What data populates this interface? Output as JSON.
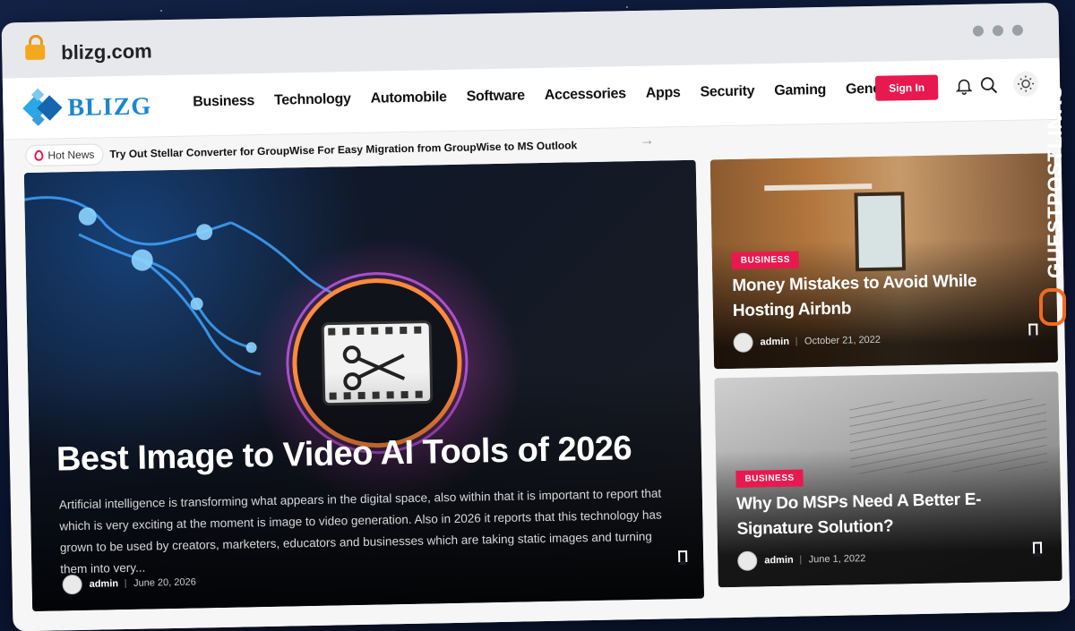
{
  "browser": {
    "url": "blizg.com"
  },
  "header": {
    "logo_text": "BLIZG",
    "nav": [
      "Business",
      "Technology",
      "Automobile",
      "Software",
      "Accessories",
      "Apps",
      "Security",
      "Gaming",
      "General"
    ],
    "signin_label": "Sign In"
  },
  "ticker": {
    "label": "Hot News",
    "headline": "Try Out Stellar Converter for GroupWise For Easy Migration from GroupWise to MS Outlook",
    "arrow": "→"
  },
  "hero": {
    "title": "Best Image to Video AI Tools of 2026",
    "excerpt": "Artificial intelligence is transforming what appears in the digital space, also within that it is important to report that which is very exciting at the moment is image to video generation. Also in 2026 it reports that this technology has grown to be used by creators, marketers, educators and businesses which are taking static images and turning them into very...",
    "author": "admin",
    "date": "June 20, 2026"
  },
  "cards": [
    {
      "category": "BUSINESS",
      "title": "Money Mistakes to Avoid While Hosting Airbnb",
      "author": "admin",
      "date": "October 21, 2022"
    },
    {
      "category": "BUSINESS",
      "title": "Why Do MSPs Need A Better E-Signature Solution?",
      "author": "admin",
      "date": "June 1, 2022"
    }
  ],
  "watermark": {
    "text": "GUESTPOSTLINKS"
  },
  "colors": {
    "accent": "#e8194f",
    "logo": "#1a86d1",
    "lock": "#f4a81d",
    "watermark_ring": "#f26a21"
  },
  "icons": [
    "lock-icon",
    "bell-icon",
    "search-icon",
    "theme-toggle-icon",
    "flame-icon",
    "bookmark-icon",
    "arrow-right-icon"
  ]
}
